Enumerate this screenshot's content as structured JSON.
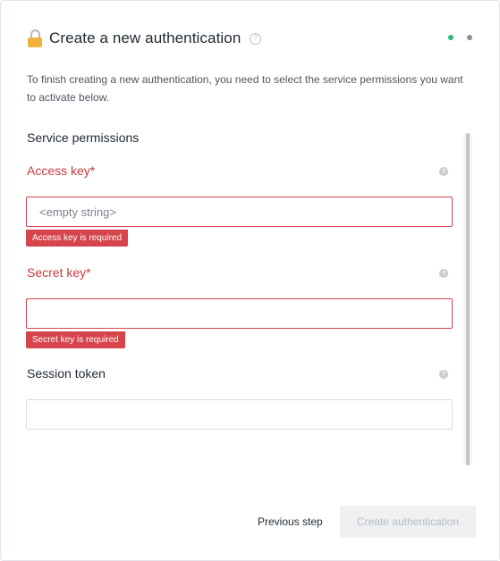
{
  "header": {
    "title": "Create a new authentication",
    "help_glyph": "?",
    "icons": {
      "lock": "lock-icon",
      "help": "help-circle-icon"
    },
    "steps": [
      {
        "name": "step-1",
        "color": "#2dbb7b"
      },
      {
        "name": "step-2",
        "color": "#8a8f96"
      }
    ]
  },
  "description": "To finish creating a new authentication, you need to select the service permissions you want to activate below.",
  "section": {
    "title": "Service permissions"
  },
  "fields": {
    "access_key": {
      "label": "Access key*",
      "value": "<empty string>",
      "error": "Access key is required",
      "help_glyph": "?"
    },
    "secret_key": {
      "label": "Secret key*",
      "value": "",
      "error": "Secret key is required",
      "help_glyph": "?"
    },
    "session_token": {
      "label": "Session token",
      "value": "",
      "help_glyph": "?"
    }
  },
  "footer": {
    "previous_label": "Previous step",
    "create_label": "Create authentication"
  },
  "colors": {
    "error": "#d6454b",
    "success_dot": "#2dbb7b",
    "disabled_button": "#eef0f2"
  }
}
